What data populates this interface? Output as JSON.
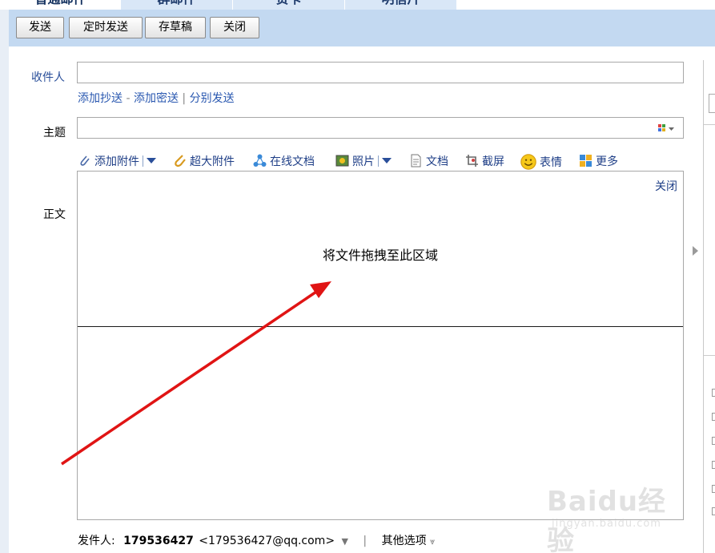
{
  "tabs": [
    {
      "label": "普通邮件",
      "active": true
    },
    {
      "label": "群邮件",
      "active": false
    },
    {
      "label": "贺卡",
      "active": false
    },
    {
      "label": "明信片",
      "active": false
    }
  ],
  "toolbar": {
    "send_label": "发送",
    "scheduled_send_label": "定时发送",
    "save_draft_label": "存草稿",
    "close_label": "关闭"
  },
  "form": {
    "to_label": "收件人",
    "to_value": "",
    "add_cc_label": "添加抄送",
    "dash": "-",
    "add_bcc_label": "添加密送",
    "bar": "|",
    "separate_send_label": "分别发送",
    "subject_label": "主题",
    "subject_value": "",
    "body_label": "正文"
  },
  "attach_bar": {
    "add_attachment": "添加附件",
    "large_attachment": "超大附件",
    "online_doc": "在线文档",
    "photo": "照片",
    "document": "文档",
    "screenshot": "截屏",
    "emoji": "表情",
    "more": "更多"
  },
  "dropzone": {
    "close_label": "关闭",
    "hint": "将文件拖拽至此区域"
  },
  "sender": {
    "label": "发件人:",
    "name": "179536427",
    "email": "<179536427@qq.com>",
    "separator": "|",
    "other_options": "其他选项"
  },
  "watermark": {
    "brand": "Baidu经验",
    "url": "jingyan.baidu.com"
  },
  "colors": {
    "toolbar_bg": "#c3d9f1",
    "link": "#2a58b0",
    "annotation_arrow": "#e01414"
  }
}
